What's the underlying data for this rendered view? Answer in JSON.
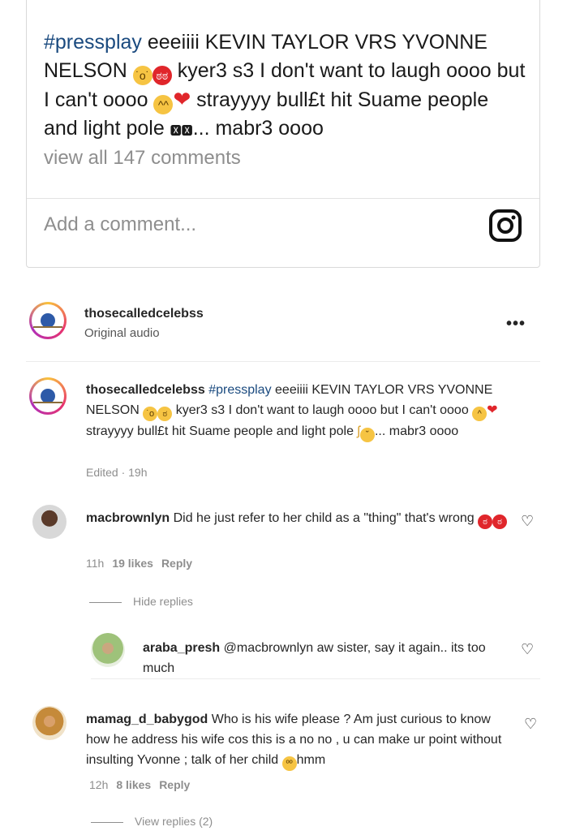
{
  "post": {
    "hashtag": "#pressplay",
    "caption_part1": " eeeiiii KEVIN TAYLOR VRS YVONNE NELSON ",
    "caption_part2": " kyer3 s3 I don't want to laugh oooo but I can't oooo ",
    "caption_part3": " strayyyy bull£t hit Suame people and light pole ",
    "caption_glyphs": "🆇🆇",
    "caption_part4": "... mabr3 oooo",
    "view_all_comments": "view all 147 comments",
    "add_comment_placeholder": "Add a comment..."
  },
  "audio": {
    "username": "thosecalledcelebss",
    "label": "Original audio"
  },
  "caption_comment": {
    "username": "thosecalledcelebss",
    "hashtag": "#pressplay",
    "text1": " eeeiiii KEVIN TAYLOR VRS YVONNE NELSON ",
    "text2": " kyer3 s3 I don't want to laugh oooo but I can't oooo ",
    "text3": " strayyyy bull£t hit Suame people and light pole ",
    "text4": "... mabr3 oooo",
    "edited": "Edited · 19h"
  },
  "comments": [
    {
      "username": "macbrownlyn",
      "text": " Did he just refer to her child as a \"thing\" that's wrong ",
      "time": "11h",
      "likes": "19 likes",
      "reply": "Reply",
      "toggle_replies": "Hide replies"
    },
    {
      "username": "araba_presh",
      "text": " @macbrownlyn aw sister, say it again.. its too much"
    },
    {
      "username": "mamag_d_babygod",
      "text": " Who is his wife please ? Am just curious to know how he address his wife cos this is a no no , u can make ur point without insulting Yvonne ; talk of her child ",
      "text_end": "hmm",
      "time": "12h",
      "likes": "8 likes",
      "reply": "Reply",
      "toggle_replies": "View replies (2)"
    }
  ],
  "colors": {
    "hashtag": "#1a4a7f",
    "emoji_angry": "#e0262b",
    "emoji_yellow": "#f6c443",
    "muted": "#8e8e8e"
  }
}
